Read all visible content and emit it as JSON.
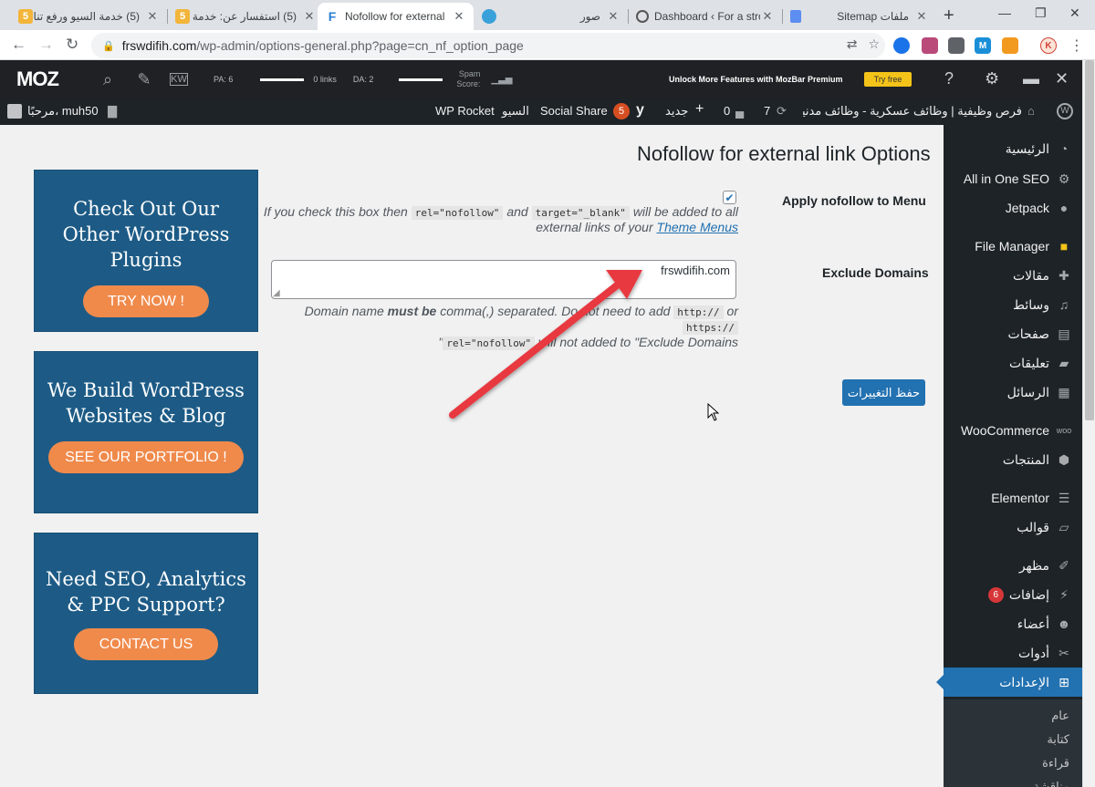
{
  "browser": {
    "tabs": [
      {
        "title": "(5) خدمة السيو ورفع تنا",
        "favicon": "5"
      },
      {
        "title": "(5) استفسار عن: خدمة",
        "favicon": "5"
      },
      {
        "title": "Nofollow for external",
        "favicon": "F"
      },
      {
        "title": "",
        "favicon": "camera"
      },
      {
        "title": "صور",
        "favicon": ""
      },
      {
        "title": "Dashboard ‹ For a stro",
        "favicon": "wordpress"
      },
      {
        "title": "ملفات Sitemap",
        "favicon": "doc"
      }
    ],
    "url_host": "frswdifih.com",
    "url_path": "/wp-admin/options-general.php?page=cn_nf_option_page",
    "new_tab": "+",
    "minimize": "—",
    "restore": "❐",
    "extensions": [
      "M",
      "K"
    ]
  },
  "mozbar": {
    "logo": "MOZ",
    "pa": "PA: 6",
    "links": "0 links",
    "da": "DA: 2",
    "spam_label_1": "Spam",
    "spam_label_2": "Score:",
    "unlock_text": "Unlock More Features with MozBar Premium",
    "try_free": "Try free",
    "help": "?"
  },
  "adminbar": {
    "greeting": "مرحبًا، muh50",
    "site_name": "فرص وظيفية | وظائف عسكرية - وظائف مدنية...",
    "updates_count": "7",
    "comments_count": "0",
    "new_label": "جديد",
    "yoast_count": "5",
    "social_share": "Social Share",
    "seo": "السيو",
    "wp_rocket": "WP Rocket"
  },
  "sidebar": {
    "items": [
      {
        "label": "الرئيسية",
        "icon": "dashboard-icon"
      },
      {
        "label": "All in One SEO",
        "icon": "gear-icon"
      },
      {
        "label": "Jetpack",
        "icon": "jetpack-icon"
      },
      {
        "label": "File Manager",
        "icon": "folder-icon"
      },
      {
        "label": "مقالات",
        "icon": "pin-icon"
      },
      {
        "label": "وسائط",
        "icon": "media-icon"
      },
      {
        "label": "صفحات",
        "icon": "page-icon"
      },
      {
        "label": "تعليقات",
        "icon": "comment-icon"
      },
      {
        "label": "الرسائل",
        "icon": "form-icon"
      },
      {
        "label": "WooCommerce",
        "icon": "woo-icon"
      },
      {
        "label": "المنتجات",
        "icon": "box-icon"
      },
      {
        "label": "Elementor",
        "icon": "elementor-icon"
      },
      {
        "label": "قوالب",
        "icon": "folder-open-icon"
      },
      {
        "label": "مظهر",
        "icon": "brush-icon"
      },
      {
        "label": "إضافات",
        "icon": "plugin-icon",
        "badge": "6"
      },
      {
        "label": "أعضاء",
        "icon": "user-icon"
      },
      {
        "label": "أدوات",
        "icon": "wrench-icon"
      },
      {
        "label": "الإعدادات",
        "icon": "settings-icon"
      }
    ],
    "submenu": [
      "عام",
      "كتابة",
      "قراءة",
      "مناقشة"
    ]
  },
  "content": {
    "page_title": "Nofollow for external link Options",
    "menu_label": "Apply nofollow to Menu",
    "menu_checked": true,
    "menu_desc_1a": "If you check this box then",
    "menu_desc_code1": "rel=\"nofollow\"",
    "menu_desc_and": "and",
    "menu_desc_code2": "target=\"_blank\"",
    "menu_desc_1b": "will be added to all",
    "menu_desc_2": "external links of your",
    "menu_desc_link": "Theme Menus",
    "exclude_label": "Exclude Domains",
    "exclude_value": "frswdifih.com",
    "exclude_desc_1a": "Domain name",
    "exclude_desc_bold": "must be",
    "exclude_desc_1b": "comma(,) separated. Do not need to add",
    "exclude_desc_code1": "http://",
    "exclude_desc_or": "or",
    "exclude_desc_code2": "https://",
    "exclude_desc_3a": "\"",
    "exclude_desc_code3": "rel=\"nofollow\"",
    "exclude_desc_3b": "will not added to \"Exclude Domains",
    "save_button": "حفظ التغييرات"
  },
  "promos": [
    {
      "title": "Check Out Our Other WordPress Plugins",
      "button": "TRY NOW !"
    },
    {
      "title": "We Build WordPress Websites & Blog",
      "button": "SEE OUR PORTFOLIO !"
    },
    {
      "title": "Need SEO, Analytics & PPC Support?",
      "button": "CONTACT US"
    }
  ],
  "colors": {
    "wp_blue": "#2271b1",
    "admin_dark": "#1d2327",
    "promo_bg": "#1d5b86",
    "promo_button": "#f08a4b",
    "annotation_arrow": "#e8393f"
  }
}
